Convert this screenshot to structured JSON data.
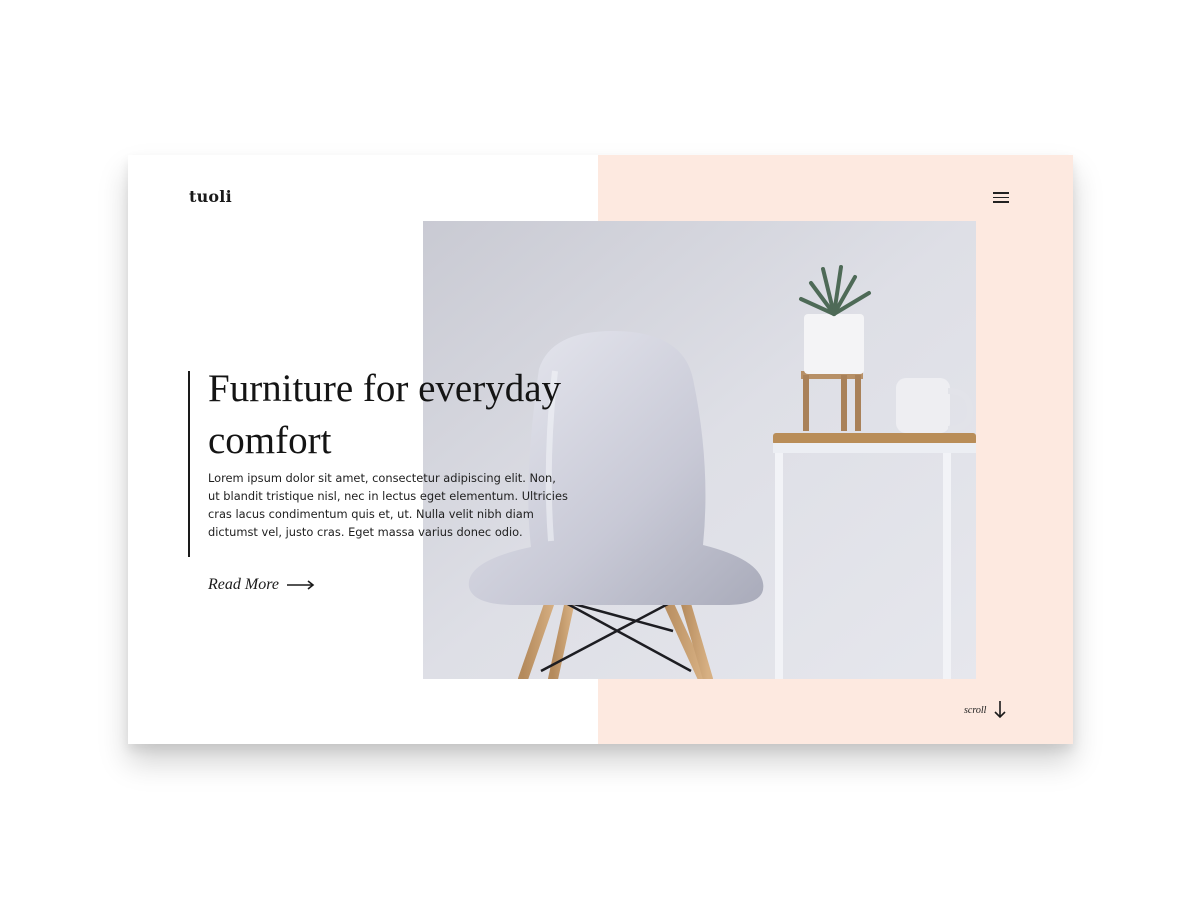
{
  "brand": {
    "name": "tuoli"
  },
  "nav": {
    "menu_icon": "hamburger-icon"
  },
  "hero": {
    "title": "Furniture for everyday comfort",
    "body": "Lorem ipsum dolor sit amet, consectetur adipiscing elit. Non, ut blandit tristique nisl, nec in lectus eget elementum. Ultricies cras lacus condimentum quis et, ut. Nulla velit nibh diam dictumst vel, justo cras. Eget massa varius donec odio.",
    "read_more_label": "Read More",
    "read_more_icon": "arrow-right-icon"
  },
  "scroll": {
    "label": "scroll",
    "icon": "arrow-down-icon"
  },
  "colors": {
    "accent_panel": "#fde9e0",
    "text": "#141414"
  }
}
